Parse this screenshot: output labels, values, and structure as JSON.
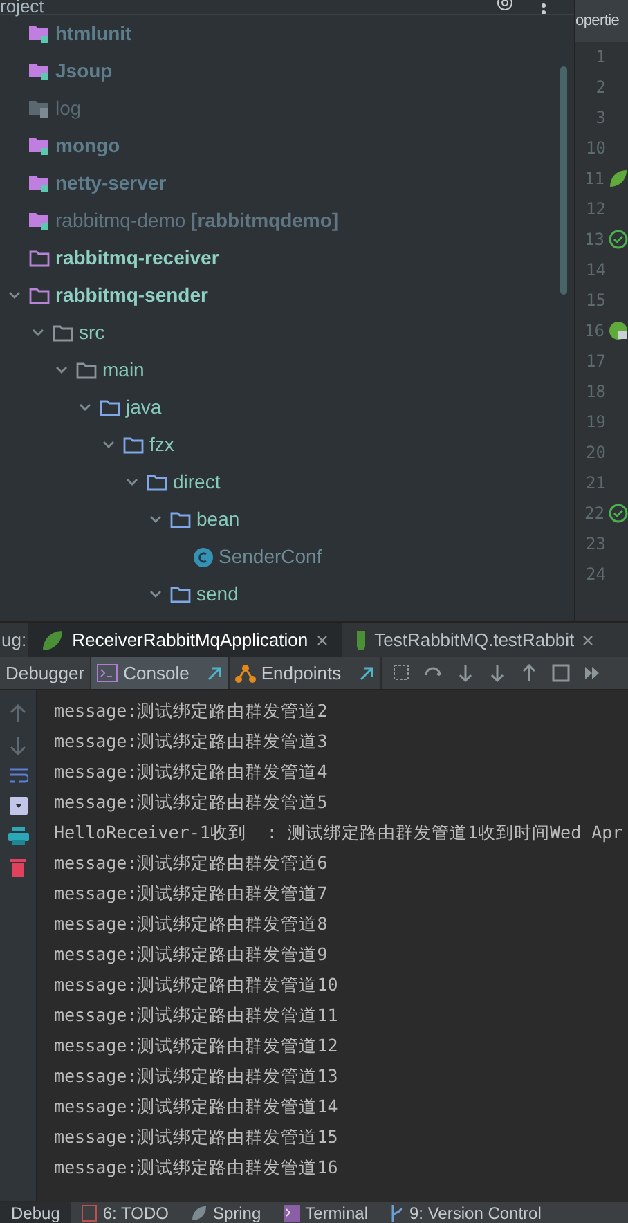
{
  "project_panel": {
    "title": "roject",
    "tree": [
      {
        "label": "htmlunit",
        "kind": "module"
      },
      {
        "label": "Jsoup",
        "kind": "module"
      },
      {
        "label": "log",
        "kind": "excluded"
      },
      {
        "label": "mongo",
        "kind": "module"
      },
      {
        "label": "netty-server",
        "kind": "module"
      },
      {
        "label": "rabbitmq-demo **[rabbitmqdemo]**",
        "kind": "module-plain"
      },
      {
        "label": "rabbitmq-receiver",
        "kind": "root"
      },
      {
        "label": "rabbitmq-sender",
        "kind": "root",
        "expanded": true,
        "children": [
          {
            "label": "src",
            "kind": "folder",
            "expanded": true,
            "children": [
              {
                "label": "main",
                "kind": "folder",
                "expanded": true,
                "children": [
                  {
                    "label": "java",
                    "kind": "package",
                    "expanded": true,
                    "children": [
                      {
                        "label": "fzx",
                        "kind": "package",
                        "expanded": true,
                        "children": [
                          {
                            "label": "direct",
                            "kind": "package",
                            "expanded": true,
                            "children": [
                              {
                                "label": "bean",
                                "kind": "package",
                                "expanded": true,
                                "children": [
                                  {
                                    "label": "SenderConf",
                                    "kind": "class"
                                  }
                                ]
                              },
                              {
                                "label": "send",
                                "kind": "package",
                                "expanded": true
                              }
                            ]
                          }
                        ]
                      }
                    ]
                  }
                ]
              }
            ]
          }
        ]
      }
    ]
  },
  "editor": {
    "tab": "opertie",
    "gutter": [
      {
        "number": "1"
      },
      {
        "number": "2"
      },
      {
        "number": "3"
      },
      {
        "number": "10"
      },
      {
        "number": "11",
        "kind": "spring"
      },
      {
        "number": "12"
      },
      {
        "number": "13",
        "kind": "check"
      },
      {
        "number": "14"
      },
      {
        "number": "15"
      },
      {
        "number": "16",
        "kind": "spring-run"
      },
      {
        "number": "17"
      },
      {
        "number": "18"
      },
      {
        "number": "19"
      },
      {
        "number": "20"
      },
      {
        "number": "21"
      },
      {
        "number": "22",
        "kind": "check"
      },
      {
        "number": "23"
      },
      {
        "number": "24"
      }
    ]
  },
  "debug": {
    "label": "ug:",
    "sessions": [
      {
        "label": "ReceiverRabbitMqApplication",
        "kind": "spring",
        "selected": true
      },
      {
        "label": "TestRabbitMQ.testRabbit",
        "kind": "test",
        "selected": false
      }
    ],
    "tabs": [
      {
        "label": "Debugger",
        "kind": "plain",
        "selected": false
      },
      {
        "label": "Console",
        "kind": "console",
        "selected": true
      },
      {
        "label": "Endpoints",
        "kind": "endpoints",
        "selected": false
      }
    ],
    "console_lines": [
      "message:测试绑定路由群发管道2",
      "message:测试绑定路由群发管道3",
      "message:测试绑定路由群发管道4",
      "message:测试绑定路由群发管道5",
      "HelloReceiver-1收到  : 测试绑定路由群发管道1收到时间Wed Apr",
      "message:测试绑定路由群发管道6",
      "message:测试绑定路由群发管道7",
      "message:测试绑定路由群发管道8",
      "message:测试绑定路由群发管道9",
      "message:测试绑定路由群发管道10",
      "message:测试绑定路由群发管道11",
      "message:测试绑定路由群发管道12",
      "message:测试绑定路由群发管道13",
      "message:测试绑定路由群发管道14",
      "message:测试绑定路由群发管道15",
      "message:测试绑定路由群发管道16"
    ]
  },
  "tool_windows": [
    {
      "label": "Debug",
      "kind": "debug",
      "selected": true
    },
    {
      "label": "6: TODO",
      "kind": "todo",
      "selected": false
    },
    {
      "label": "Spring",
      "kind": "spring",
      "selected": false
    },
    {
      "label": "Terminal",
      "kind": "terminal",
      "selected": false
    },
    {
      "label": "9: Version Control",
      "kind": "vcs",
      "selected": false
    }
  ]
}
